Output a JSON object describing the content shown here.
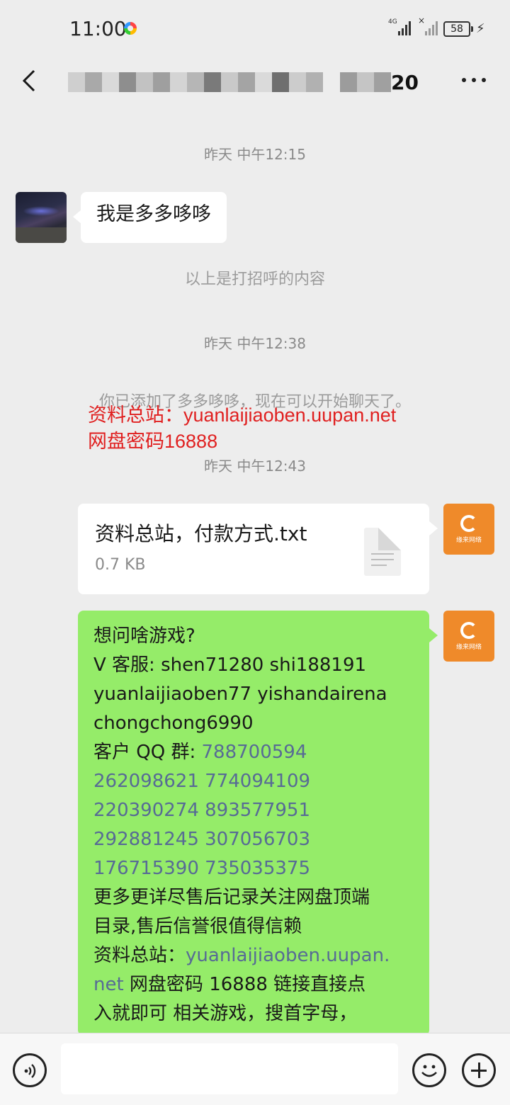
{
  "status": {
    "time": "11:00",
    "network": "4G",
    "battery": "58"
  },
  "nav": {
    "title_visible_suffix": "20"
  },
  "chat": {
    "timestamps": [
      "昨天 中午12:15",
      "昨天 中午12:38",
      "昨天 中午12:43"
    ],
    "greeting_bubble": "我是多多哆哆",
    "greeting_caption": "以上是打招呼的内容",
    "added_notice": "你已添加了多多哆哆，现在可以开始聊天了。",
    "overlay_line1": "资料总站：yuanlaijiaoben.uupan.net",
    "overlay_line2": "网盘密码16888",
    "file": {
      "name": "资料总站，付款方式.txt",
      "size": "0.7 KB"
    },
    "brand_text": "缘来网络",
    "long_message": {
      "l1": "想问啥游戏?",
      "l2": "V 客服: shen71280 shi188191",
      "l3": "yuanlaijiaoben77 yishandairena",
      "l4": "chongchong6990",
      "l5a": "客户 QQ 群:  ",
      "l5b": "788700594",
      "l6a": "262098621",
      "l6b": " 774094109",
      "l7a": "220390274 893577951",
      "l8a": "292881245 307056703",
      "l9a": "176715390 735035375",
      "l10": "更多更详尽售后记录关注网盘顶端",
      "l11": "目录,售后信誉很值得信赖",
      "l12a": "资料总站：",
      "l12b": "yuanlaijiaoben.uupan.",
      "l13a": "net",
      "l13b": " 网盘密码 16888 链接直接点",
      "l14": "入就即可 相关游戏，搜首字母，"
    }
  },
  "colors": {
    "background": "#ededed",
    "green_bubble": "#95ec69",
    "link": "#576b95",
    "overlay_red": "#e02020",
    "brand_orange": "#ef8a2a"
  },
  "icons": [
    "back-icon",
    "more-icon",
    "file-icon",
    "voice-icon",
    "emoji-icon",
    "plus-icon"
  ]
}
